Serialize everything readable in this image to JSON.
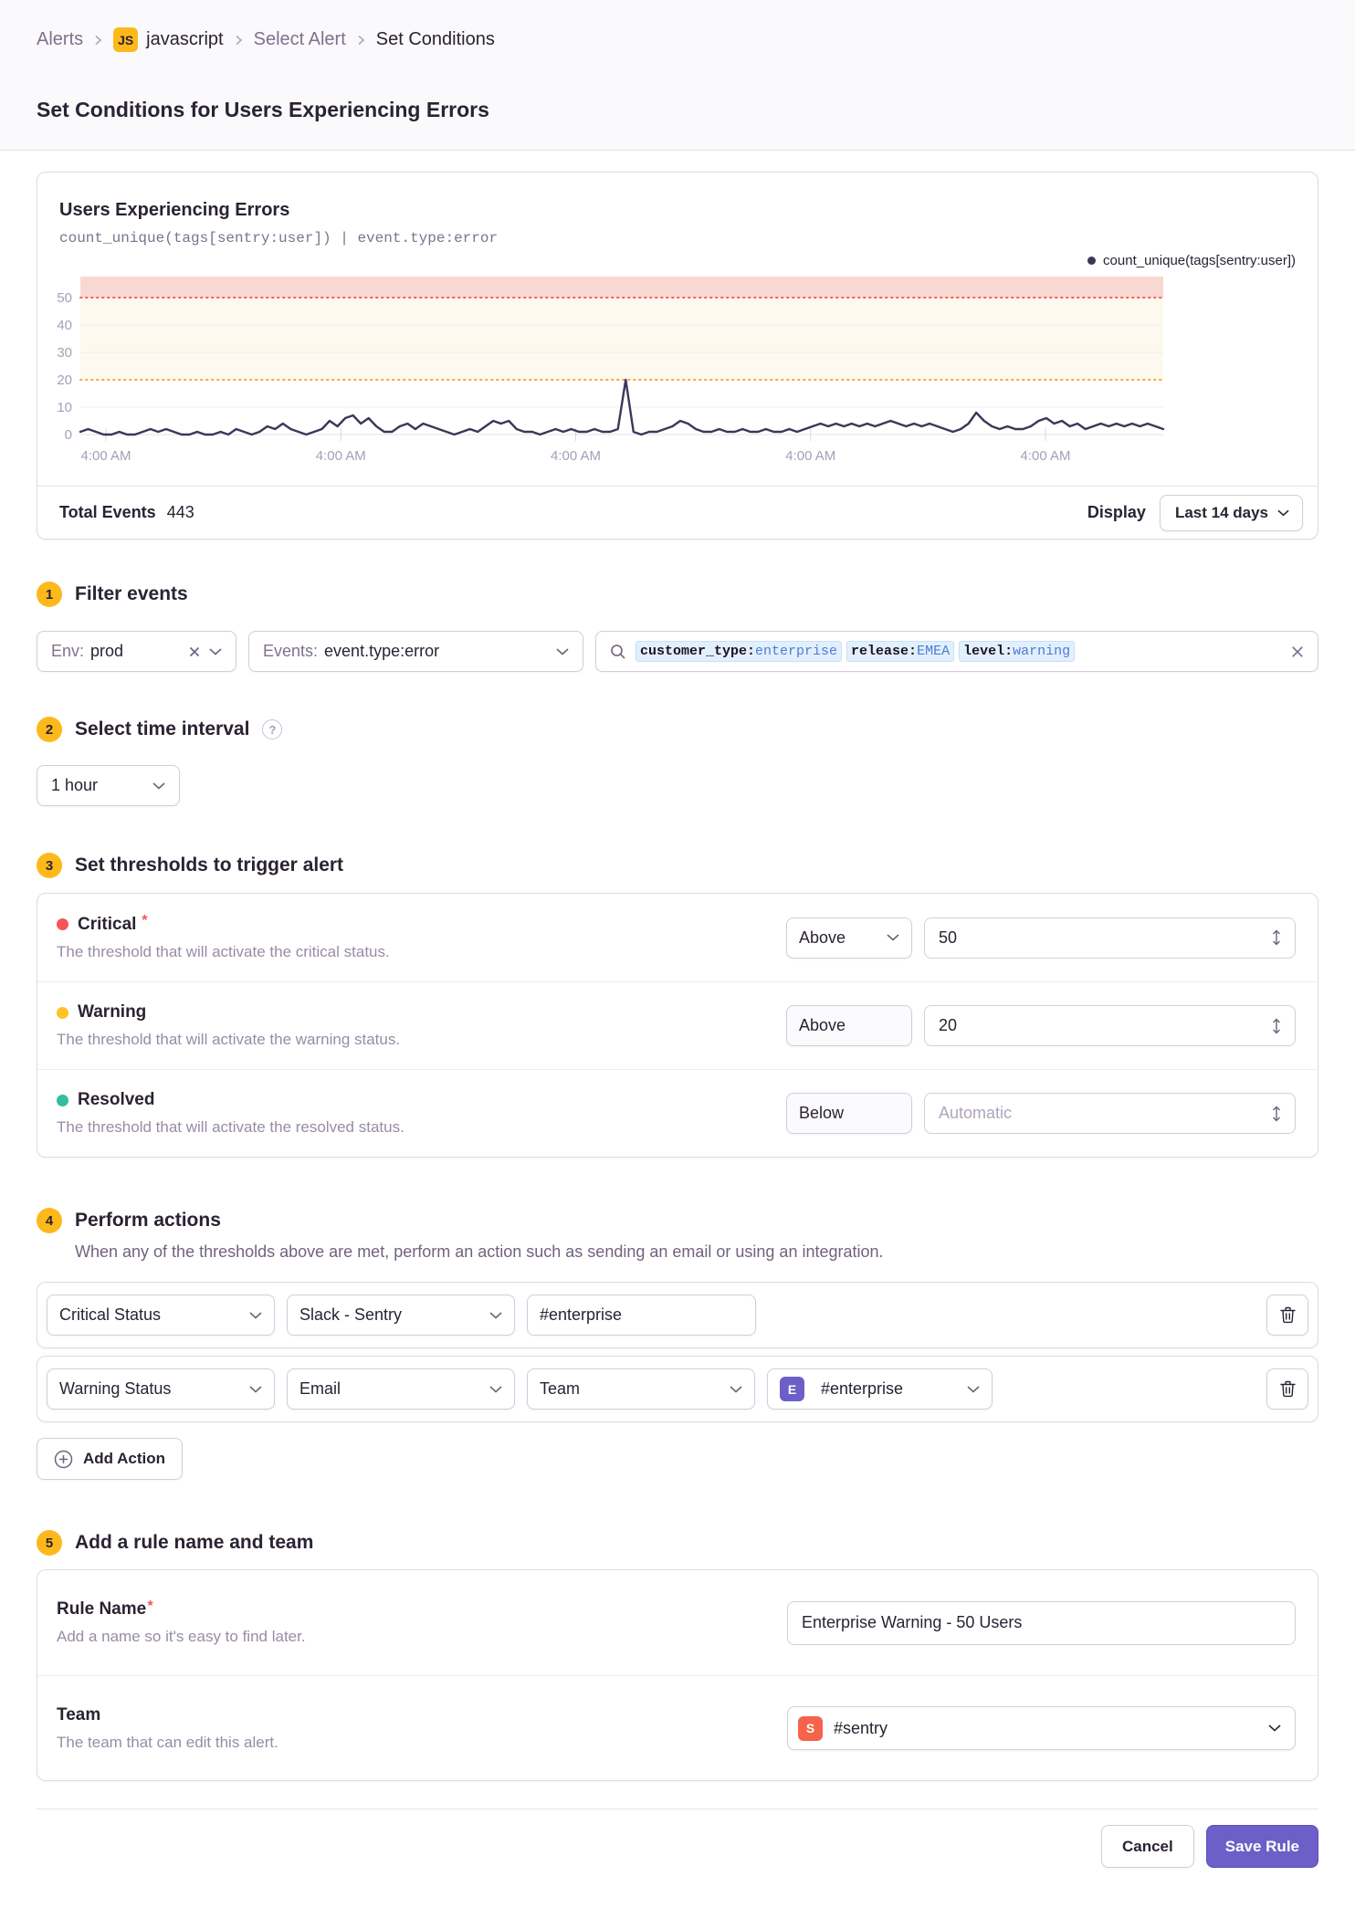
{
  "breadcrumb": {
    "alerts": "Alerts",
    "project_badge": "JS",
    "project": "javascript",
    "select_alert": "Select Alert",
    "current": "Set Conditions"
  },
  "page": {
    "title": "Set Conditions for Users Experiencing Errors"
  },
  "chart": {
    "title": "Users Experiencing Errors",
    "query": "count_unique(tags[sentry:user]) | event.type:error",
    "total_events_label": "Total Events",
    "total_events_value": "443",
    "display_label": "Display",
    "display_value": "Last 14 days"
  },
  "chart_data": {
    "type": "line",
    "title": "Users Experiencing Errors",
    "x_tick_labels": [
      "4:00 AM",
      "4:00 AM",
      "4:00 AM",
      "4:00 AM",
      "4:00 AM"
    ],
    "y_ticks": [
      0,
      10,
      20,
      30,
      40,
      50
    ],
    "ylim": [
      0,
      57.7
    ],
    "grid_on": true,
    "legend_position": "top-right",
    "line_color": "#3E3659",
    "grid_color": "#F0ECF3",
    "baseline_color": "#E3DDE8",
    "axis_label_color": "#A89DB8",
    "thresholds": {
      "critical": {
        "value": 50,
        "color": "#F55E5A",
        "band_color": "#FAD8D2"
      },
      "warning": {
        "value": 20,
        "color": "#F7A93B",
        "band_color": "#FEF9EF"
      }
    },
    "series": [
      {
        "name": "count_unique(tags[sentry:user])",
        "values": [
          1,
          2,
          1,
          0,
          0,
          1,
          0,
          0,
          1,
          2,
          1,
          2,
          1,
          0,
          0,
          1,
          0,
          0,
          1,
          0,
          2,
          1,
          0,
          1,
          3,
          2,
          4,
          2,
          1,
          0,
          1,
          2,
          5,
          3,
          6,
          7,
          4,
          6,
          3,
          1,
          1,
          3,
          4,
          2,
          4,
          3,
          2,
          1,
          0,
          1,
          2,
          1,
          3,
          5,
          4,
          5,
          2,
          1,
          1,
          0,
          1,
          2,
          1,
          2,
          1,
          1,
          2,
          1,
          1,
          2,
          20,
          1,
          0,
          1,
          1,
          2,
          3,
          5,
          4,
          2,
          1,
          1,
          2,
          1,
          1,
          2,
          1,
          1,
          2,
          1,
          1,
          2,
          1,
          2,
          3,
          4,
          3,
          4,
          3,
          4,
          3,
          4,
          3,
          4,
          5,
          4,
          3,
          4,
          3,
          4,
          3,
          2,
          1,
          2,
          4,
          8,
          5,
          3,
          2,
          3,
          2,
          2,
          3,
          5,
          6,
          4,
          5,
          3,
          4,
          2,
          3,
          4,
          3,
          4,
          3,
          4,
          3,
          4,
          3,
          2
        ]
      }
    ]
  },
  "sections": {
    "filter": {
      "number": "1",
      "title": "Filter events",
      "env": {
        "label": "Env:",
        "value": "prod"
      },
      "events": {
        "label": "Events:",
        "value": "event.type:error"
      },
      "search": {
        "tokens": [
          {
            "key": "customer_type:",
            "value": "enterprise"
          },
          {
            "key": "release:",
            "value": "EMEA"
          },
          {
            "key": "level:",
            "value": "warning"
          }
        ]
      }
    },
    "interval": {
      "number": "2",
      "title": "Select time interval",
      "help": "?",
      "value": "1 hour"
    },
    "thresholds": {
      "number": "3",
      "title": "Set thresholds to trigger alert",
      "rows": [
        {
          "name": "Critical",
          "required_mark": "*",
          "dot_color": "#F55459",
          "description": "The threshold that will activate the critical status.",
          "operator": "Above",
          "value": "50"
        },
        {
          "name": "Warning",
          "dot_color": "#FFC227",
          "description": "The threshold that will activate the warning status.",
          "operator": "Above",
          "value": "20"
        },
        {
          "name": "Resolved",
          "dot_color": "#33BF9E",
          "description": "The threshold that will activate the resolved status.",
          "operator": "Below",
          "placeholder": "Automatic"
        }
      ]
    },
    "actions": {
      "number": "4",
      "title": "Perform actions",
      "description": "When any of the thresholds above are met, perform an action such as sending an email or using an integration.",
      "rows": [
        {
          "trigger": "Critical Status",
          "service": "Slack - Sentry",
          "target": "#enterprise"
        },
        {
          "trigger": "Warning Status",
          "service": "Email",
          "target_type": "Team",
          "team": {
            "avatar": "E",
            "avatar_color": "#6C5FC7",
            "label": "#enterprise"
          }
        }
      ],
      "add_action_label": "Add Action"
    },
    "naming": {
      "number": "5",
      "title": "Add a rule name and team",
      "rule_name": {
        "label": "Rule Name",
        "required_mark": "*",
        "description": "Add a name so it's easy to find later.",
        "value": "Enterprise Warning - 50 Users"
      },
      "team": {
        "label": "Team",
        "description": "The team that can edit this alert.",
        "avatar": "S",
        "avatar_color": "#F4634A",
        "value": "#sentry"
      }
    }
  },
  "footer": {
    "cancel_label": "Cancel",
    "save_label": "Save Rule"
  }
}
